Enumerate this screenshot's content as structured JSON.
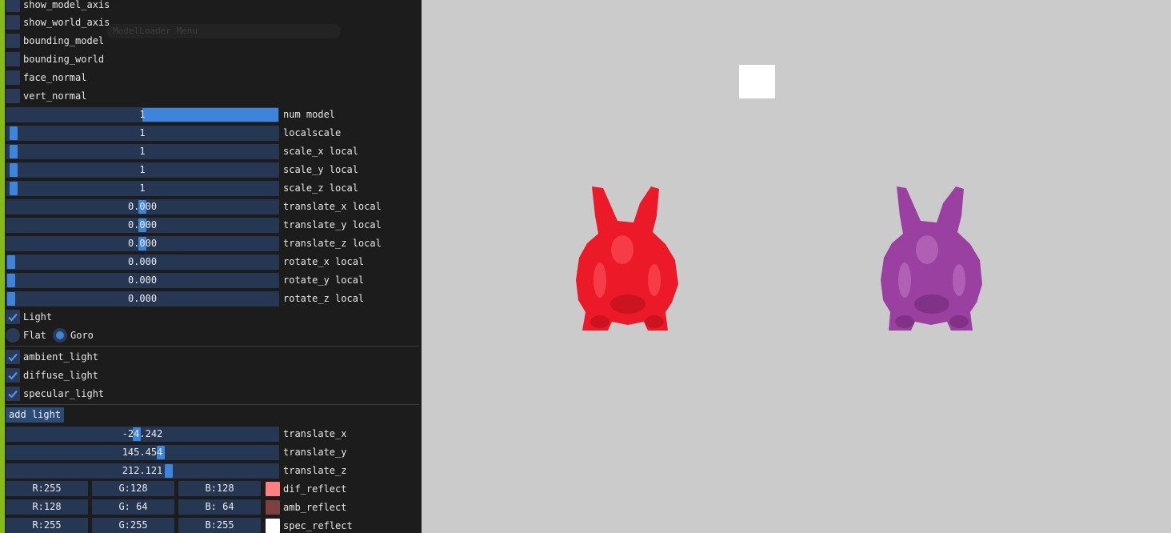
{
  "menu": {
    "ghost_title": "ModelLoader Menu"
  },
  "toggles_top": [
    {
      "label": "show_model_axis",
      "checked": false
    },
    {
      "label": "show_world_axis",
      "checked": false
    },
    {
      "label": "bounding_model",
      "checked": false
    },
    {
      "label": "bounding_world",
      "checked": false
    },
    {
      "label": "face_normal",
      "checked": false
    },
    {
      "label": "vert_normal",
      "checked": false
    }
  ],
  "model_sliders": [
    {
      "label": "num model",
      "value": "1",
      "fraction": 0.5
    },
    {
      "label": "localscale",
      "value": "1",
      "fraction": 0.01
    },
    {
      "label": "scale_x local",
      "value": "1",
      "fraction": 0.01
    },
    {
      "label": "scale_y local",
      "value": "1",
      "fraction": 0.01
    },
    {
      "label": "scale_z local",
      "value": "1",
      "fraction": 0.01
    },
    {
      "label": "translate_x local",
      "value": "0.000",
      "fraction": 0.5
    },
    {
      "label": "translate_y local",
      "value": "0.000",
      "fraction": 0.5
    },
    {
      "label": "translate_z local",
      "value": "0.000",
      "fraction": 0.5
    },
    {
      "label": "rotate_x local",
      "value": "0.000",
      "fraction": 0.0
    },
    {
      "label": "rotate_y local",
      "value": "0.000",
      "fraction": 0.0
    },
    {
      "label": "rotate_z local",
      "value": "0.000",
      "fraction": 0.0
    }
  ],
  "light_toggle": {
    "label": "Light",
    "checked": true
  },
  "shading": [
    {
      "label": "Flat",
      "selected": false
    },
    {
      "label": "Goro",
      "selected": true
    }
  ],
  "light_types": [
    {
      "label": "ambient_light",
      "checked": true
    },
    {
      "label": "diffuse_light",
      "checked": true
    },
    {
      "label": "specular_light",
      "checked": true
    }
  ],
  "add_light_label": "add light",
  "light_sliders": [
    {
      "label": "translate_x",
      "value": "-24.242",
      "fraction": 0.48
    },
    {
      "label": "translate_y",
      "value": "145.454",
      "fraction": 0.57
    },
    {
      "label": "translate_z",
      "value": "212.121",
      "fraction": 0.6
    }
  ],
  "reflect_rows": [
    {
      "label": "dif_reflect",
      "r": "R:255",
      "g": "G:128",
      "b": "B:128",
      "swatch": "#ff8080"
    },
    {
      "label": "amb_reflect",
      "r": "R:128",
      "g": "G: 64",
      "b": "B: 64",
      "swatch": "#804040"
    },
    {
      "label": "spec_reflect",
      "r": "R:255",
      "g": "G:255",
      "b": "B:255",
      "swatch": "#ffffff"
    }
  ],
  "colors": {
    "panel_bg": "#1c1c1c",
    "accent_edge": "#86b91c",
    "frame_bg": "#263754",
    "grab": "#3e84db",
    "viewport_bg": "#cbcbcb",
    "bunny_left": "#ee1b2a",
    "bunny_right": "#9c42a2"
  }
}
